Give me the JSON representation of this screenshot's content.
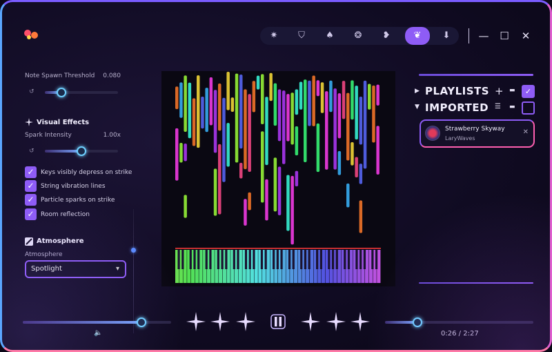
{
  "toolbar": {
    "buttons": [
      {
        "icon": "sparkle-icon",
        "glyph": "✷"
      },
      {
        "icon": "wizard-hat-icon",
        "glyph": "⛉"
      },
      {
        "icon": "strawberry-icon",
        "glyph": "♠"
      },
      {
        "icon": "swirl-icon",
        "glyph": "❂"
      },
      {
        "icon": "heart-icon",
        "glyph": "❥"
      },
      {
        "icon": "effects-icon",
        "glyph": "❦"
      },
      {
        "icon": "download-icon",
        "glyph": "⬇"
      }
    ],
    "minimize_glyph": "—",
    "maximize_glyph": "☐",
    "close_glyph": "✕"
  },
  "left_panel": {
    "note_spawn": {
      "label": "Note Spawn Threshold",
      "value": "0.080",
      "level": 0.23
    },
    "visual_effects": {
      "title": "Visual Effects",
      "spark_label": "Spark Intensity",
      "spark_value": "1.00x",
      "spark_level": 0.5
    },
    "checkboxes": [
      {
        "label": "Keys visibly depress on strike",
        "checked": true
      },
      {
        "label": "String vibration lines",
        "checked": true
      },
      {
        "label": "Particle sparks on strike",
        "checked": true
      },
      {
        "label": "Room reflection",
        "checked": true
      }
    ],
    "atmosphere": {
      "title": "Atmosphere",
      "field_label": "Atmosphere",
      "selected": "Spotlight"
    },
    "check_glyph": "✓",
    "reset_glyph": "↺",
    "dropdown_glyph": "▾"
  },
  "right_panel": {
    "playlists_label": "PLAYLISTS",
    "imported_label": "IMPORTED",
    "add_glyph": "+",
    "folder_glyph": "▬",
    "list_glyph": "☰",
    "expand_glyph": "▶",
    "collapse_glyph": "▼",
    "track": {
      "title": "Strawberry Skyway",
      "artist": "LaryWaves",
      "close_glyph": "✕"
    }
  },
  "player": {
    "volume_level": 0.8,
    "progress_level": 0.22,
    "current_time": "0:26",
    "total_time": "2:27",
    "volume_glyph": "🔈"
  },
  "colors": {
    "accent": "#8e5cf6",
    "knob": "#6fd0ff"
  }
}
